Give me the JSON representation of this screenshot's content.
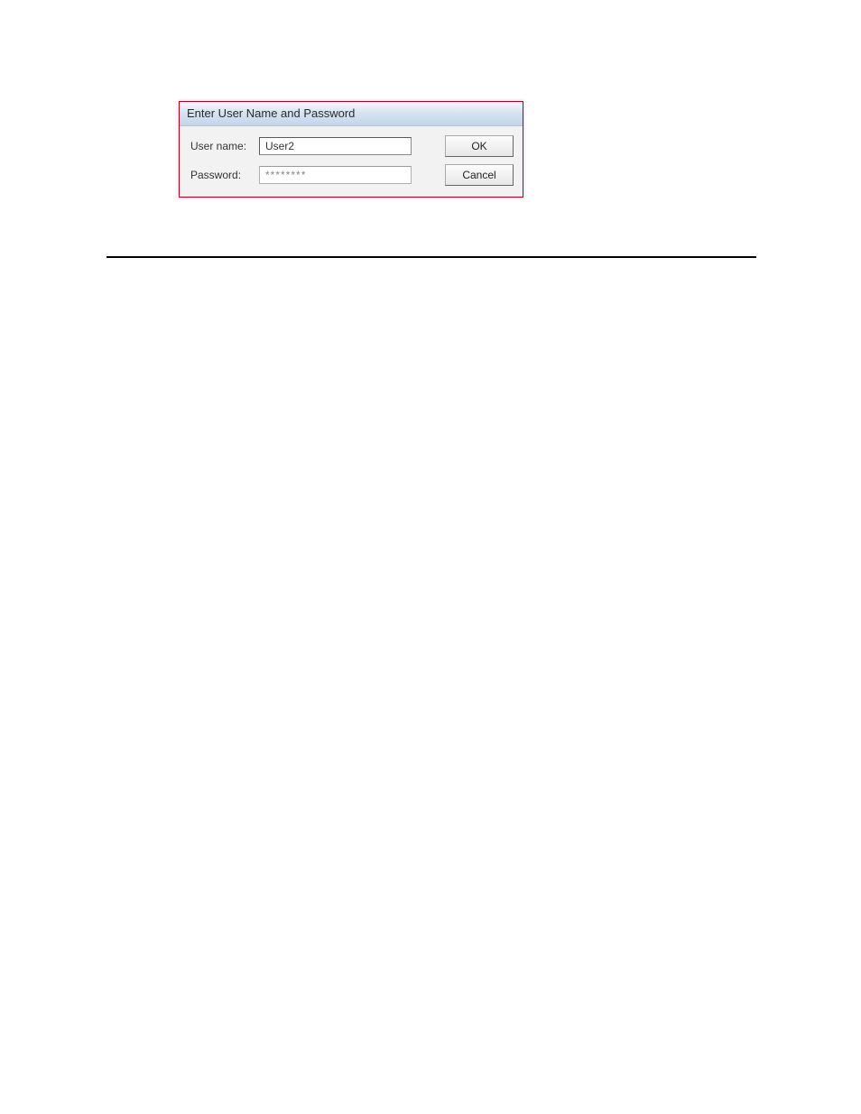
{
  "dialog": {
    "title": "Enter User Name and Password",
    "username_label": "User name:",
    "username_value": "User2",
    "password_label": "Password:",
    "password_value": "********",
    "ok_label": "OK",
    "cancel_label": "Cancel"
  }
}
